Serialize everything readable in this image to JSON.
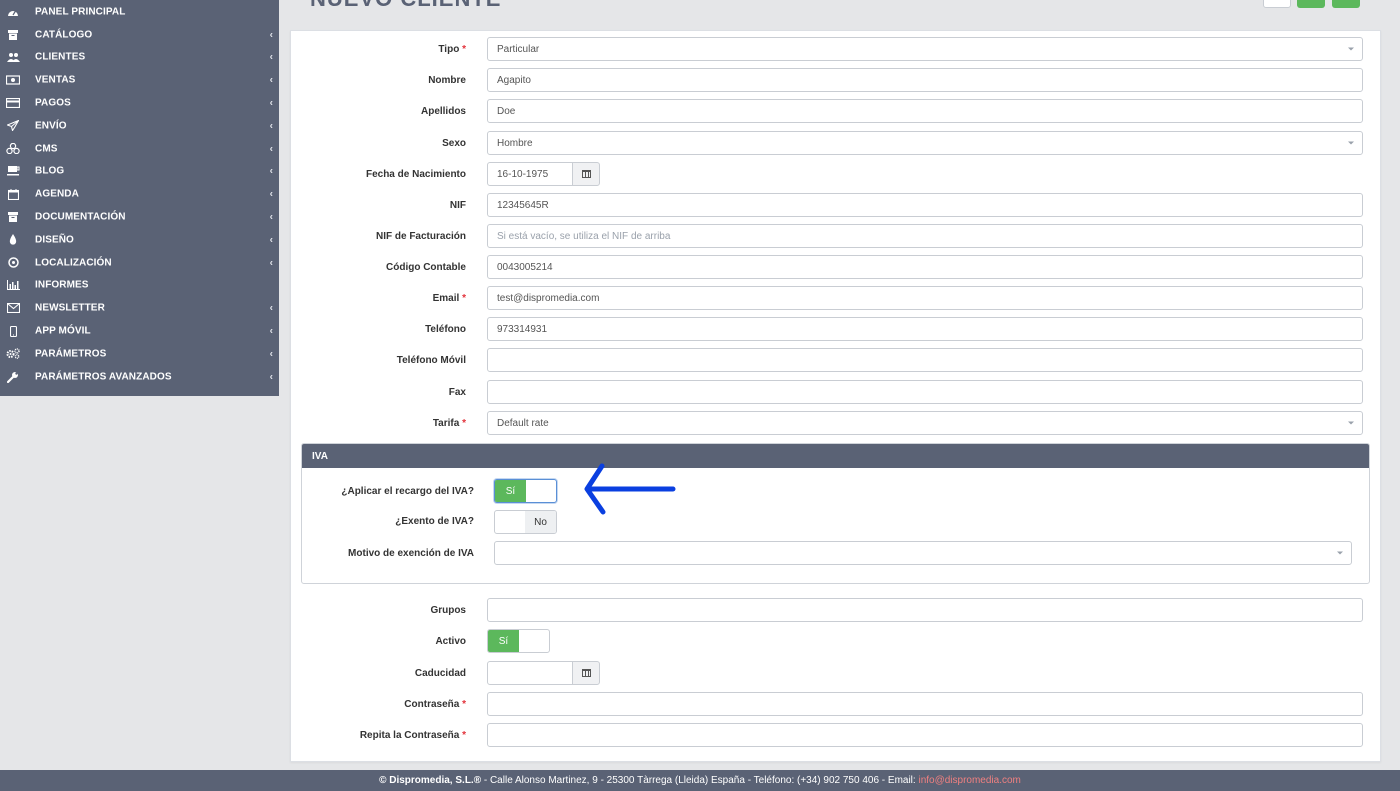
{
  "sidebar": {
    "items": [
      {
        "label": "PANEL PRINCIPAL",
        "icon": "dashboard-icon",
        "has_children": false
      },
      {
        "label": "CATÁLOGO",
        "icon": "archive-icon",
        "has_children": true
      },
      {
        "label": "CLIENTES",
        "icon": "users-icon",
        "has_children": true
      },
      {
        "label": "VENTAS",
        "icon": "money-icon",
        "has_children": true
      },
      {
        "label": "PAGOS",
        "icon": "credit-card-icon",
        "has_children": true
      },
      {
        "label": "ENVÍO",
        "icon": "paper-plane-icon",
        "has_children": true
      },
      {
        "label": "CMS",
        "icon": "cubes-icon",
        "has_children": true
      },
      {
        "label": "BLOG",
        "icon": "coffee-icon",
        "has_children": true
      },
      {
        "label": "AGENDA",
        "icon": "calendar-icon",
        "has_children": true
      },
      {
        "label": "DOCUMENTACIÓN",
        "icon": "archive-icon",
        "has_children": true
      },
      {
        "label": "DISEÑO",
        "icon": "tint-icon",
        "has_children": true
      },
      {
        "label": "LOCALIZACIÓN",
        "icon": "globe-icon",
        "has_children": true
      },
      {
        "label": "INFORMES",
        "icon": "bar-chart-icon",
        "has_children": false
      },
      {
        "label": "NEWSLETTER",
        "icon": "envelope-icon",
        "has_children": true
      },
      {
        "label": "APP MÓVIL",
        "icon": "mobile-icon",
        "has_children": true
      },
      {
        "label": "PARÁMETROS",
        "icon": "cogs-icon",
        "has_children": true
      },
      {
        "label": "PARÁMETROS AVANZADOS",
        "icon": "wrench-icon",
        "has_children": true
      }
    ]
  },
  "page": {
    "title": "NUEVO CLIENTE"
  },
  "form": {
    "tipo": {
      "label": "Tipo",
      "value": "Particular"
    },
    "nombre": {
      "label": "Nombre",
      "value": "Agapito"
    },
    "apellidos": {
      "label": "Apellidos",
      "value": "Doe"
    },
    "sexo": {
      "label": "Sexo",
      "value": "Hombre"
    },
    "fecha_nacimiento": {
      "label": "Fecha de Nacimiento",
      "value": "16-10-1975"
    },
    "nif": {
      "label": "NIF",
      "value": "12345645R"
    },
    "nif_facturacion": {
      "label": "NIF de Facturación",
      "placeholder": "Si está vacío, se utiliza el NIF de arriba"
    },
    "codigo_contable": {
      "label": "Código Contable",
      "value": "0043005214"
    },
    "email": {
      "label": "Email",
      "value": "test@dispromedia.com"
    },
    "telefono": {
      "label": "Teléfono",
      "value": "973314931"
    },
    "telefono_movil": {
      "label": "Teléfono Móvil",
      "value": ""
    },
    "fax": {
      "label": "Fax",
      "value": ""
    },
    "tarifa": {
      "label": "Tarifa",
      "value": "Default rate"
    },
    "grupos": {
      "label": "Grupos",
      "value": ""
    },
    "activo": {
      "label": "Activo",
      "on_label": "Sí",
      "state": "on"
    },
    "caducidad": {
      "label": "Caducidad",
      "value": ""
    },
    "contrasena": {
      "label": "Contraseña",
      "value": ""
    },
    "repita_contrasena": {
      "label": "Repita la Contraseña",
      "value": ""
    },
    "required_mark": "*"
  },
  "iva": {
    "heading": "IVA",
    "aplicar_recargo": {
      "label": "¿Aplicar el recargo del IVA?",
      "on_label": "Sí",
      "state": "on"
    },
    "exento": {
      "label": "¿Exento de IVA?",
      "off_label": "No",
      "state": "off"
    },
    "motivo_exencion": {
      "label": "Motivo de exención de IVA",
      "value": ""
    }
  },
  "annotation": {
    "color": "#0a3fe0"
  },
  "colors": {
    "sidebar_bg": "#5a6275",
    "switch_on": "#5cb85c",
    "required": "#e2323b",
    "footer_email": "#f08080"
  },
  "footer": {
    "company": "© Dispromedia, S.L.®",
    "address": " - Calle Alonso Martinez, 9 - 25300 Tàrrega (Lleida) España - Teléfono: (+34) 902 750 406 - Email: ",
    "email": "info@dispromedia.com"
  }
}
